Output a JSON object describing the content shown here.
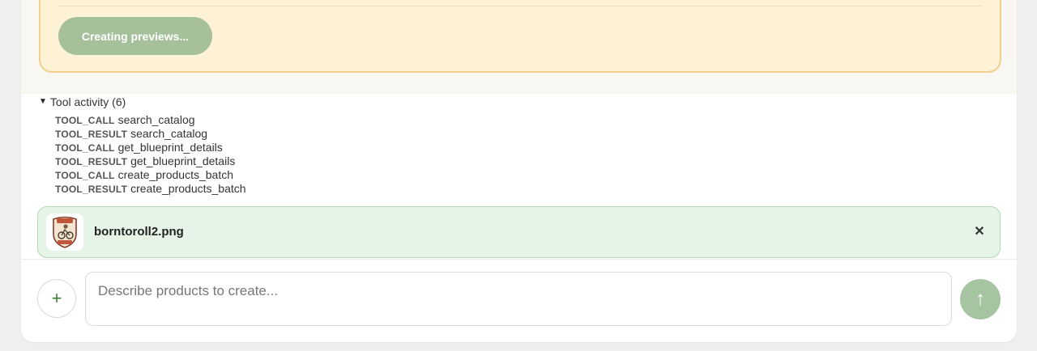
{
  "preview": {
    "status_button_label": "Creating previews..."
  },
  "tool_activity": {
    "summary_label": "Tool activity (6)",
    "toggle_glyph": "▼",
    "items": [
      {
        "kind": "TOOL_CALL",
        "name": "search_catalog"
      },
      {
        "kind": "TOOL_RESULT",
        "name": "search_catalog"
      },
      {
        "kind": "TOOL_CALL",
        "name": "get_blueprint_details"
      },
      {
        "kind": "TOOL_RESULT",
        "name": "get_blueprint_details"
      },
      {
        "kind": "TOOL_CALL",
        "name": "create_products_batch"
      },
      {
        "kind": "TOOL_RESULT",
        "name": "create_products_batch"
      }
    ]
  },
  "attachment": {
    "filename": "borntoroll2.png",
    "thumbnail_icon": "born-to-roll-badge-icon",
    "remove_glyph": "✕"
  },
  "composer": {
    "add_glyph": "+",
    "input_placeholder": "Describe products to create...",
    "input_value": "",
    "send_glyph": "↑"
  },
  "colors": {
    "accent_green": "#3a7d3a",
    "send_button_bg": "#a6c4a2",
    "status_button_bg": "#a6c09c",
    "card_bg": "#fdf1d6",
    "card_border": "#f1d08e",
    "chip_bg": "#e6f4e7",
    "chip_border": "#b4d8b8"
  }
}
